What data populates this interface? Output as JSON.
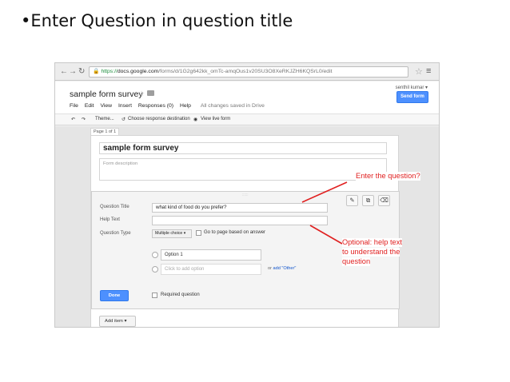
{
  "slide": {
    "title": "•Enter Question in question title"
  },
  "browser": {
    "url_https": "https://",
    "url_host": "docs.google.com",
    "url_path": "/forms/d/1G2g642kk_omTc-amqOus1v20SU3O8XeRKJZH6KQSrL0/edit",
    "back_icon": "back-arrow-icon",
    "forward_icon": "forward-arrow-icon",
    "reload_icon": "reload-icon"
  },
  "header": {
    "doc_title": "sample form survey",
    "user_name": "senthil kumar ▾",
    "send_button": "Send form",
    "menu": [
      "File",
      "Edit",
      "View",
      "Insert",
      "Responses (0)",
      "Help"
    ],
    "saved_status": "All changes saved in Drive"
  },
  "toolbar": {
    "theme": "Theme...",
    "choose_destination": "Choose response destination",
    "view_live": "View live form"
  },
  "form": {
    "page_label": "Page 1 of 1",
    "title": "sample form survey",
    "description_placeholder": "Form description"
  },
  "question": {
    "title_label": "Question Title",
    "title_value": "what kind of food do you prefer?",
    "help_label": "Help Text",
    "help_value": "",
    "type_label": "Question Type",
    "type_value": "Multiple choice ▾",
    "page_branch_label": "Go to page based on answer",
    "option1": "Option 1",
    "add_option_placeholder": "Click to add option",
    "add_other_prefix": "or ",
    "add_other_link": "add \"Other\"",
    "done_button": "Done",
    "required_label": "Required question",
    "drag_handle": "::::::"
  },
  "add_item": "Add item  ▾",
  "annotations": {
    "enter_question": "Enter the question?",
    "help_text": [
      "Optional: help text",
      "to understand the",
      "question"
    ]
  },
  "colors": {
    "accent_blue": "#4d90fe",
    "annotation_red": "#e02020"
  }
}
